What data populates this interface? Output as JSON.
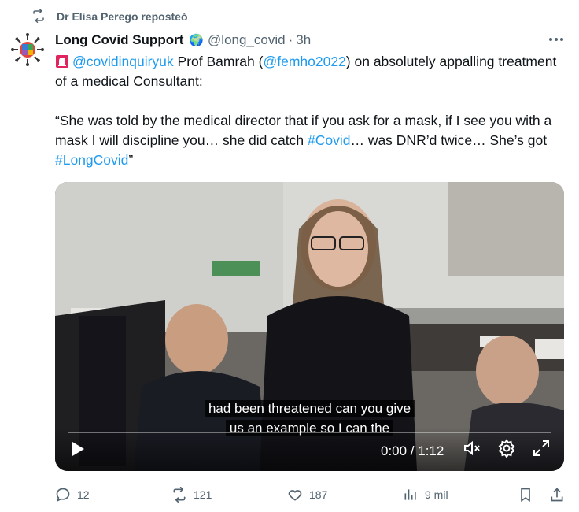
{
  "repost": {
    "label": "Dr Elisa Perego reposteó"
  },
  "author": {
    "name": "Long Covid Support",
    "badge": "🌍",
    "handle": "@long_covid",
    "separator": "·",
    "time": "3h"
  },
  "tweet": {
    "mention1": "@covidinquiryuk",
    "text1": " Prof Bamrah (",
    "mention2": "@femho2022",
    "text2": ") on absolutely appalling treatment of a medical Consultant:",
    "quote1": "“She was told by the medical director that if you ask for a mask, if I see you with a mask I will discipline you… she did catch ",
    "hashtag1": "#Covid",
    "quote2": "… was DNR’d twice… She’s got ",
    "hashtag2": "#LongCovid",
    "quote3": "”"
  },
  "video": {
    "caption_line1": "had been threatened can you give",
    "caption_line2": "us an example so I can the",
    "time": "0:00 / 1:12",
    "progress": 0
  },
  "actions": {
    "replies": "12",
    "reposts": "121",
    "likes": "187",
    "views": "9 mil"
  },
  "colors": {
    "link": "#1d9bf0",
    "muted": "#536471",
    "text": "#0f1419"
  }
}
